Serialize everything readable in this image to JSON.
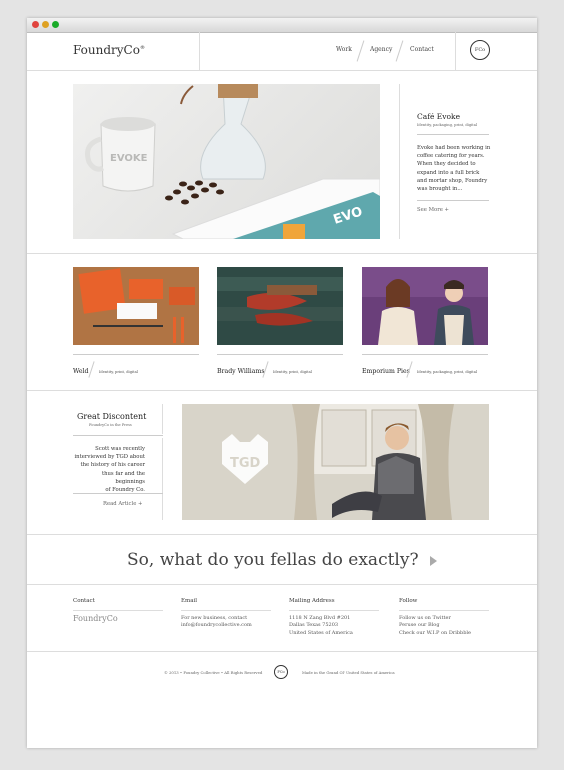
{
  "brand": {
    "name": "FoundryCo",
    "tm": "®",
    "badge": "FCo"
  },
  "nav": [
    {
      "label": "Work"
    },
    {
      "label": "Agency"
    },
    {
      "label": "Contact"
    }
  ],
  "hero": {
    "title": "Café Evoke",
    "tags": "Identity, packaging, print, digital",
    "body": [
      "Evoke had been working in",
      "coffee catering for years.",
      "When they decided to",
      "expand into a full brick",
      "and mortar shop, Foundry",
      "was brought in..."
    ],
    "more": "See More +",
    "mug_text": "EVOKE",
    "card_text": "EVO"
  },
  "projects": [
    {
      "name": "Weld",
      "tags": "Identity, print, digital"
    },
    {
      "name": "Brady Williams",
      "tags": "Identity, print, digital"
    },
    {
      "name": "Emporium Pies",
      "tags": "Identity, packaging, print, digital"
    }
  ],
  "press": {
    "title": "Great Discontent",
    "subtitle": "FoundryCo in the Press",
    "body": [
      "Scott was recently",
      "interviewed by TGD about",
      "the history of his career",
      "thus far and the beginnings",
      "of Foundry Co."
    ],
    "more": "Read Article +",
    "logo_text": "TGD"
  },
  "question": "So, what do you fellas do exactly?",
  "footer": {
    "contact": {
      "heading": "Contact",
      "logo": "FoundryCo"
    },
    "email": {
      "heading": "Email",
      "line1": "For new business, contact",
      "line2": "info@foundrycollective.com"
    },
    "address": {
      "heading": "Mailing Address",
      "lines": [
        "1118 N Zang Blvd #201",
        "Dallas Texas 75203",
        "United States of America"
      ]
    },
    "follow": {
      "heading": "Follow",
      "lines": [
        "Follow us on Twitter",
        "Peruse our Blog",
        "Check our W.I.P on Dribbble"
      ]
    }
  },
  "bottom": {
    "copyright": "© 2013 • Foundry Collective • All Rights Reserved",
    "badge": "FCo",
    "made": "Made in the Grand Ol' United States of America"
  },
  "colors": {
    "teal": "#5fa8ad",
    "orange": "#e8622b",
    "purple": "#6a3f7a"
  }
}
